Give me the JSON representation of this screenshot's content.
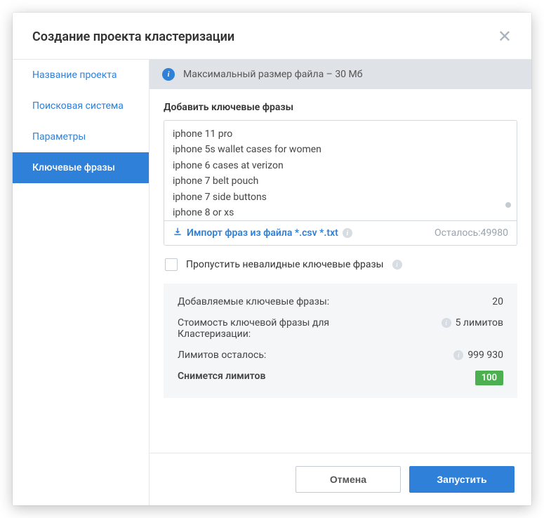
{
  "header": {
    "title": "Создание проекта кластеризации"
  },
  "sidebar": {
    "items": [
      {
        "label": "Название проекта"
      },
      {
        "label": "Поисковая система"
      },
      {
        "label": "Параметры"
      },
      {
        "label": "Ключевые фразы"
      }
    ]
  },
  "banner": {
    "text": "Максимальный размер файла – 30 Мб"
  },
  "keywords": {
    "label": "Добавить ключевые фразы",
    "value": "iphone 11 pro\niphone 5s wallet cases for women\niphone 6 cases at verizon\niphone 7 belt pouch\niphone 7 side buttons\niphone 8 or xs",
    "import_text": "Импорт фраз из файла *.csv *.txt",
    "remaining_label": "Осталось:",
    "remaining_value": "49980"
  },
  "skip_invalid": {
    "label": "Пропустить невалидные ключевые фразы"
  },
  "stats": {
    "added_label": "Добавляемые ключевые фразы:",
    "added_value": "20",
    "cost_label": "Стоимость ключевой фразы для Кластеризации:",
    "cost_value": "5 лимитов",
    "limits_left_label": "Лимитов осталось:",
    "limits_left_value": "999 930",
    "deduct_label": "Снимется лимитов",
    "deduct_value": "100"
  },
  "footer": {
    "cancel": "Отмена",
    "submit": "Запустить"
  }
}
